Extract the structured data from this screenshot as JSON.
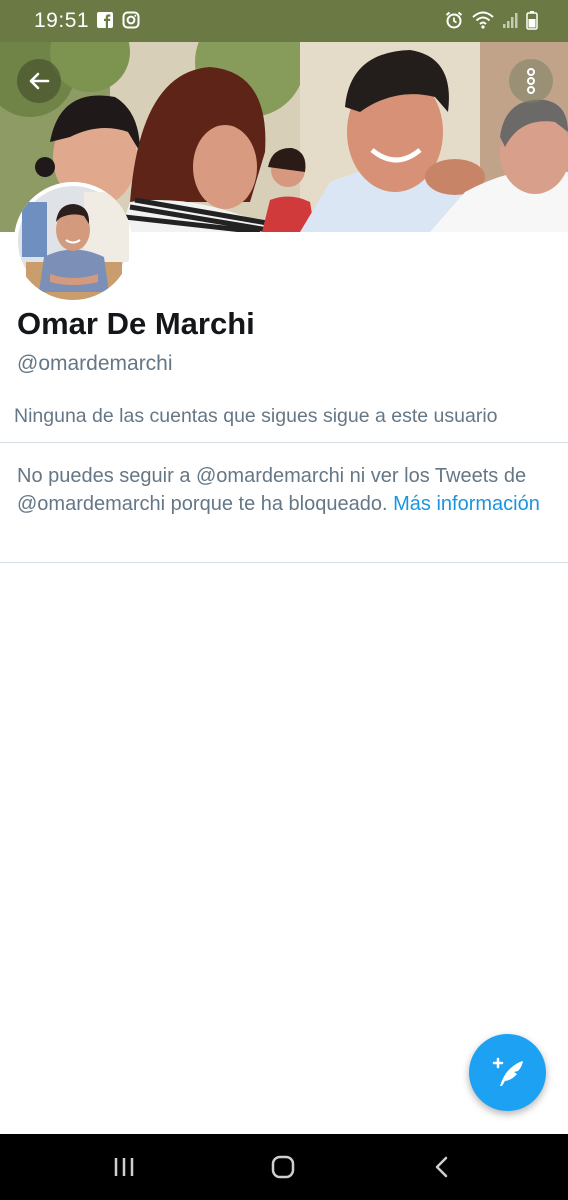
{
  "status_bar": {
    "time": "19:51",
    "left_icons": [
      "facebook-icon",
      "instagram-icon"
    ],
    "right_icons": [
      "alarm-icon",
      "wifi-icon",
      "signal-icon",
      "battery-icon"
    ],
    "background": "#6b7a44"
  },
  "header": {
    "back_icon": "back-arrow-icon",
    "more_icon": "more-vertical-icon"
  },
  "profile": {
    "display_name": "Omar De Marchi",
    "handle": "@omardemarchi",
    "followers_note": "Ninguna de las cuentas que sigues sigue a este usuario"
  },
  "blocked": {
    "message": "No puedes seguir a @omardemarchi ni ver los Tweets de @omardemarchi porque te ha bloqueado.",
    "link_label": "Más información"
  },
  "fab": {
    "icon": "compose-tweet-icon",
    "color": "#1da1f2"
  },
  "nav_bar": {
    "icons": [
      "recent-apps-icon",
      "home-icon",
      "back-icon"
    ]
  },
  "colors": {
    "link": "#1b95e0",
    "secondary_text": "#657786",
    "primary_text": "#14171a"
  }
}
